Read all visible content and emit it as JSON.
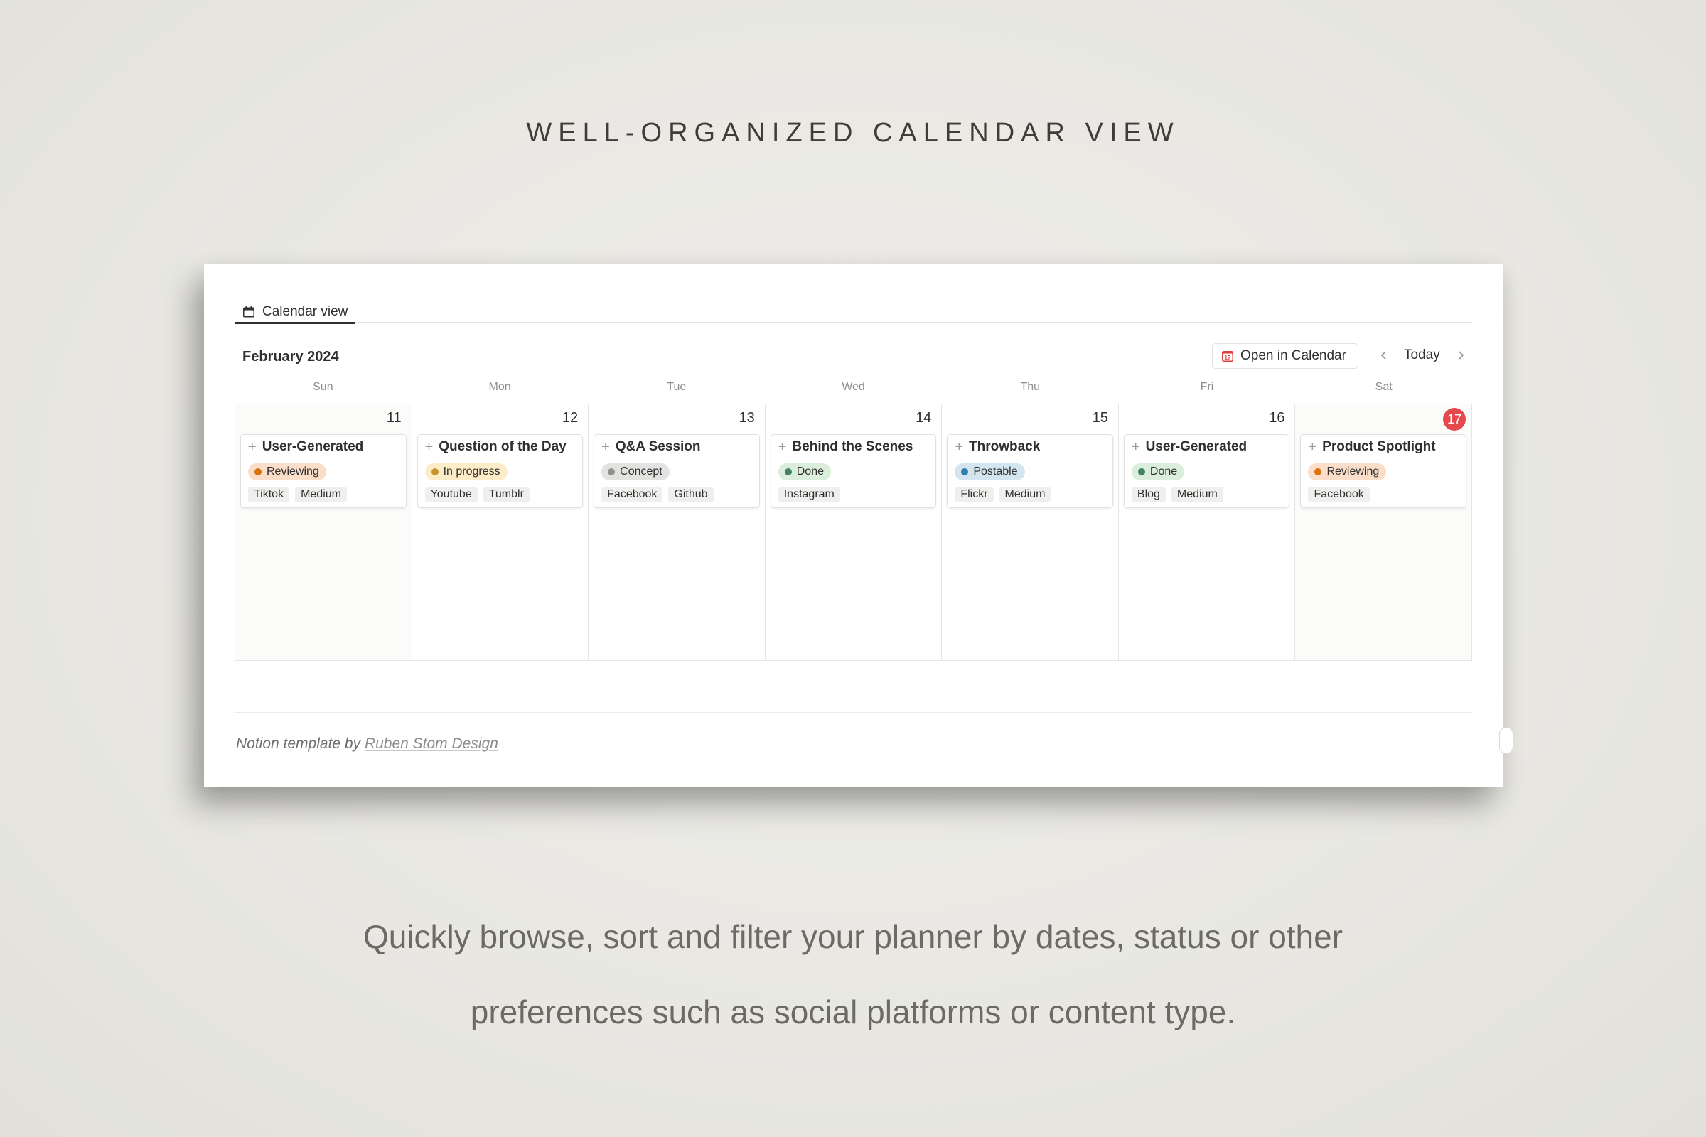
{
  "headline": "WELL-ORGANIZED CALENDAR VIEW",
  "tab": {
    "label": "Calendar view",
    "icon": "calendar-icon"
  },
  "toolbar": {
    "month": "February 2024",
    "open_calendar_label": "Open in Calendar",
    "today_label": "Today",
    "prev_icon": "chevron-left-icon",
    "next_icon": "chevron-right-icon"
  },
  "weekdays": [
    "Sun",
    "Mon",
    "Tue",
    "Wed",
    "Thu",
    "Fri",
    "Sat"
  ],
  "days": [
    {
      "num": "11",
      "title": "User-Generated",
      "status": "Reviewing",
      "status_color": "#d9730d",
      "status_bg": "#fadec9",
      "tags": [
        "Tiktok",
        "Medium"
      ]
    },
    {
      "num": "12",
      "title": "Question of the Day",
      "status": "In progress",
      "status_color": "#cb912f",
      "status_bg": "#fdecc8",
      "tags": [
        "Youtube",
        "Tumblr"
      ]
    },
    {
      "num": "13",
      "title": "Q&A Session",
      "status": "Concept",
      "status_color": "#91918e",
      "status_bg": "#e3e2e0",
      "tags": [
        "Facebook",
        "Github"
      ]
    },
    {
      "num": "14",
      "title": "Behind the Scenes",
      "status": "Done",
      "status_color": "#448361",
      "status_bg": "#dbeddb",
      "tags": [
        "Instagram"
      ]
    },
    {
      "num": "15",
      "title": "Throwback",
      "status": "Postable",
      "status_color": "#337ea9",
      "status_bg": "#d3e5ef",
      "tags": [
        "Flickr",
        "Medium"
      ]
    },
    {
      "num": "16",
      "title": "User-Generated",
      "status": "Done",
      "status_color": "#448361",
      "status_bg": "#dbeddb",
      "tags": [
        "Blog",
        "Medium"
      ]
    },
    {
      "num": "17",
      "title": "Product Spotlight",
      "status": "Reviewing",
      "status_color": "#d9730d",
      "status_bg": "#fadec9",
      "tags": [
        "Facebook"
      ],
      "is_today": true
    }
  ],
  "credit": {
    "prefix": "Notion template by ",
    "author": "Ruben Stom Design"
  },
  "subtext_line1": "Quickly browse, sort and filter your planner by dates, status or other",
  "subtext_line2": "preferences such as social platforms or content type.",
  "colors": {
    "today_badge": "#e5484d",
    "calendar_icon_red": "#e03e3e"
  }
}
